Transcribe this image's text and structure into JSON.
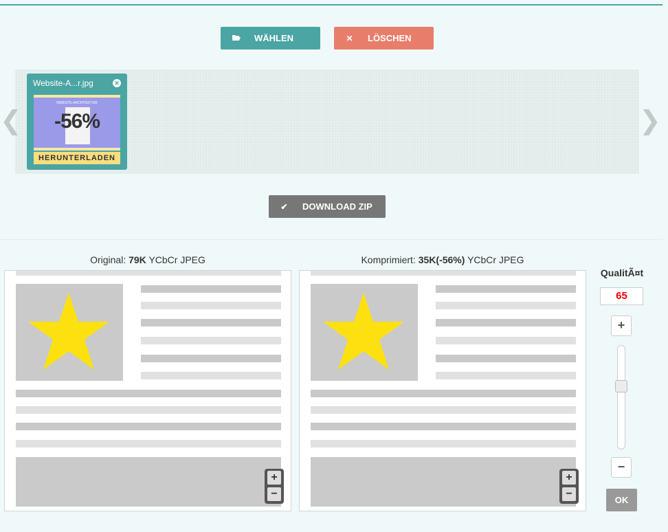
{
  "toolbar": {
    "choose_label": "WÄHLEN",
    "choose_icon": "folder-open-icon",
    "delete_label": "LÖSCHEN",
    "delete_icon": "close-icon",
    "zip_label": "DOWNLOAD ZIP",
    "zip_icon": "checkmark-icon"
  },
  "queue": {
    "items": [
      {
        "filename": "Website-A...r.jpg",
        "thumb_badge": "-56%",
        "thumb_caption": "WEBSITE-ARCHITEKTUR",
        "download_label": "HERUNTERLADEN"
      }
    ],
    "prev_arrow": "❮",
    "next_arrow": "❯"
  },
  "compare": {
    "original": {
      "prefix": "Original:",
      "size": "79K",
      "format": "YCbCr JPEG"
    },
    "compressed": {
      "prefix": "Komprimiert:",
      "size": "35K(-56%)",
      "format": "YCbCr JPEG"
    },
    "zoom_in": "+",
    "zoom_out": "−"
  },
  "quality": {
    "label": "QualitÃ¤t",
    "value": "65",
    "slider_level": 0.38,
    "plus": "+",
    "minus": "−",
    "ok_label": "OK"
  },
  "colors": {
    "accent": "#4aa5a3",
    "danger": "#e97d6b",
    "neutral": "#777777",
    "star": "#fde010",
    "quality_value": "#ee0000"
  }
}
